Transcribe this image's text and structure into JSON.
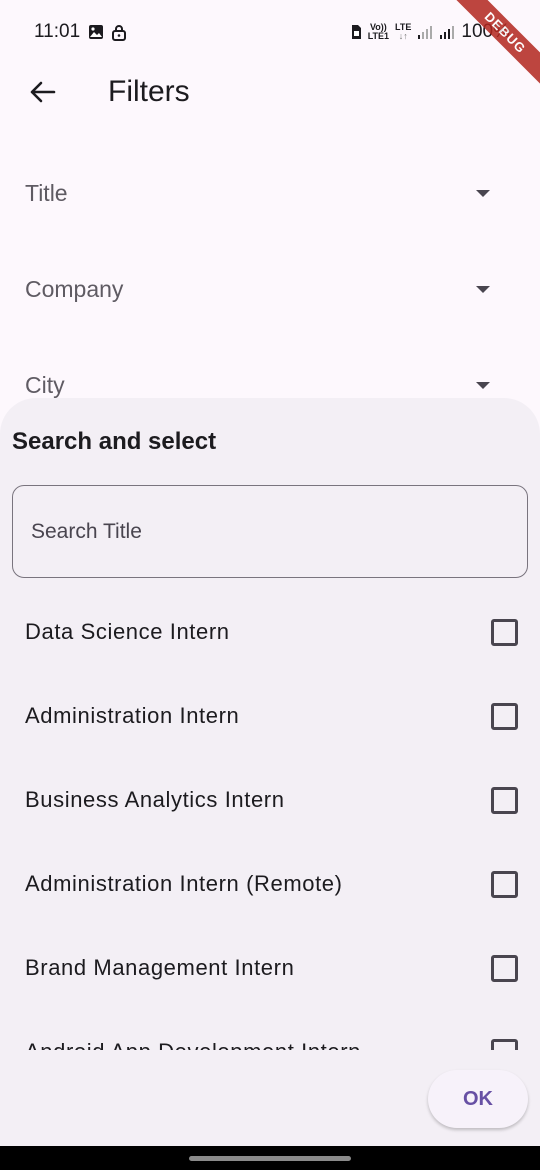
{
  "status_bar": {
    "time": "11:01",
    "lte_top": "Vo))",
    "lte_bottom": "LTE1",
    "lte2_top": "LTE",
    "battery": "100%"
  },
  "debug_banner": "DEBUG",
  "app_bar": {
    "title": "Filters"
  },
  "filters": [
    {
      "label": "Title"
    },
    {
      "label": "Company"
    },
    {
      "label": "City"
    }
  ],
  "sheet": {
    "title": "Search and select",
    "search_placeholder": "Search Title",
    "items": [
      {
        "label": "Data Science Intern",
        "checked": false
      },
      {
        "label": "Administration Intern",
        "checked": false
      },
      {
        "label": "Business Analytics Intern",
        "checked": false
      },
      {
        "label": "Administration Intern (Remote)",
        "checked": false
      },
      {
        "label": "Brand Management Intern",
        "checked": false
      },
      {
        "label": "Android App Development Intern",
        "checked": false
      }
    ],
    "ok_label": "OK"
  },
  "colors": {
    "background": "#fdf8fd",
    "sheet": "#f3eff5",
    "accent": "#6750a4",
    "debug": "#b3261e"
  }
}
